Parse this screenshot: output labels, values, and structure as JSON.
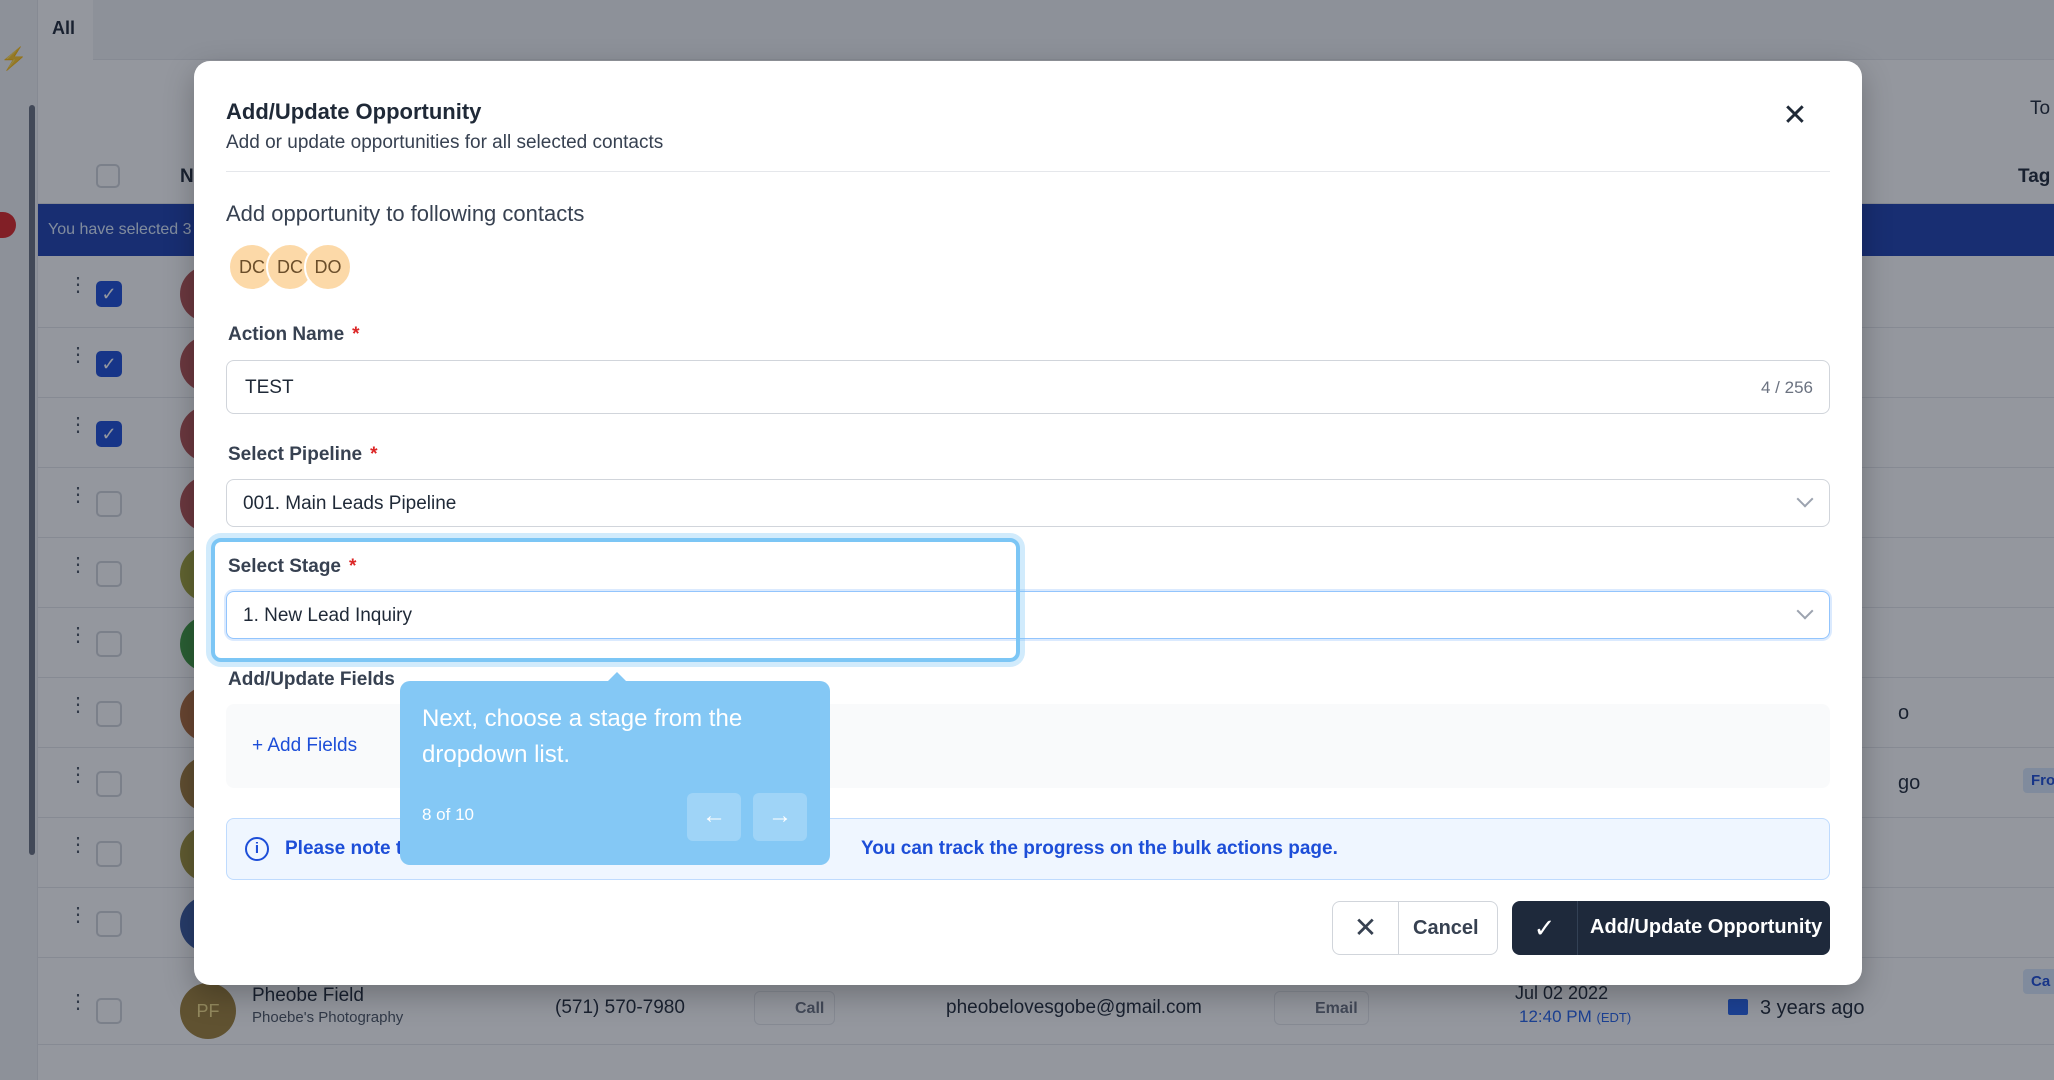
{
  "background": {
    "tab_label": "All",
    "header_name": "N",
    "header_tags": "Tag",
    "totals_partial": "To",
    "banner_text": "You have selected 3",
    "rows_partial": [
      "",
      "",
      "",
      "",
      "",
      "",
      "o",
      "go",
      "",
      "",
      ""
    ],
    "tag_pill": "Fro",
    "last_row": {
      "avatar": "PF",
      "name": "Pheobe Field",
      "company": "Phoebe's Photography",
      "phone": "(571) 570-7980",
      "call_label": "Call",
      "email": "pheobelovesgobe@gmail.com",
      "email_label": "Email",
      "date": "Jul 02 2022",
      "time": "12:40 PM",
      "tz": "(EDT)",
      "ago": "3 years ago",
      "tag": "Ca"
    }
  },
  "modal": {
    "title": "Add/Update Opportunity",
    "subtitle": "Add or update opportunities for all selected contacts",
    "contacts_heading": "Add opportunity to following contacts",
    "contact_avatars": [
      "DC",
      "DC",
      "DO"
    ],
    "action_name_label": "Action Name",
    "required_mark": "*",
    "action_name_value": "TEST",
    "action_name_counter": "4 / 256",
    "pipeline_label": "Select Pipeline",
    "pipeline_value": "001. Main Leads Pipeline",
    "stage_label": "Select Stage",
    "stage_value": "1. New Lead Inquiry",
    "fields_label": "Add/Update Fields",
    "add_fields": "+ Add Fields",
    "note_start": "Please note t",
    "note_end": "You can track the progress on the bulk actions page.",
    "cancel_label": "Cancel",
    "submit_label": "Add/Update Opportunity"
  },
  "tour": {
    "text": "Next, choose a stage from the dropdown list.",
    "step": "8 of 10",
    "prev_icon": "arrow-left-icon",
    "next_icon": "arrow-right-icon"
  },
  "colors": {
    "overlay": "#111827",
    "primary_button": "#1e293b",
    "tour_bubble": "#84c8f5",
    "avatar_bg": "#fcd9a8",
    "note_text": "#1d4ed8"
  }
}
